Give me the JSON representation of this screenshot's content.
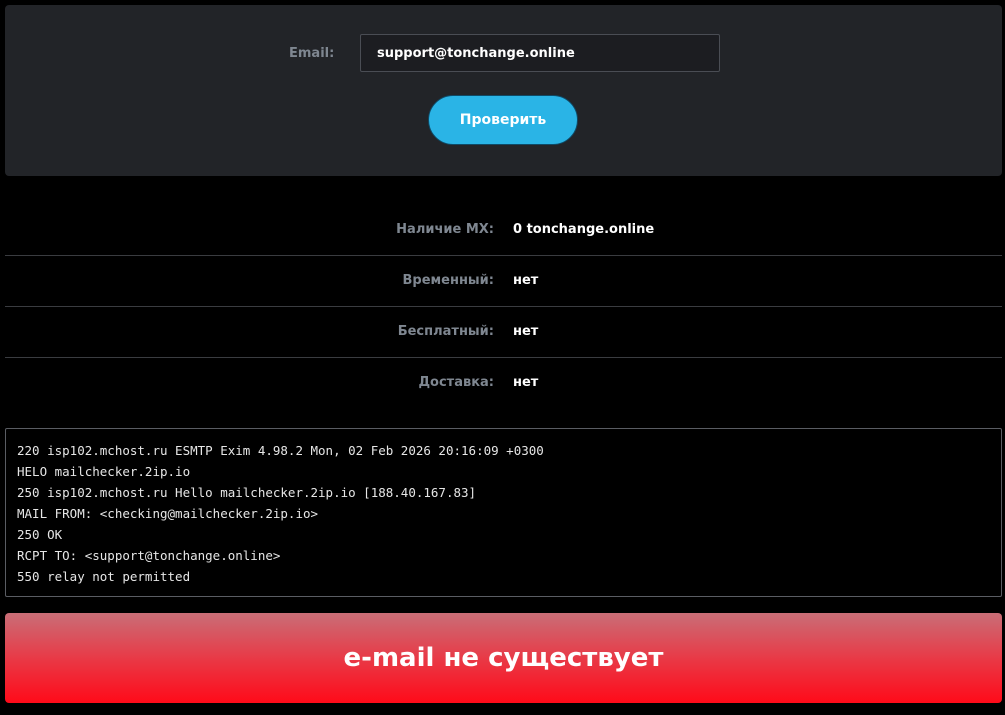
{
  "form": {
    "email_label": "Email:",
    "email_value": "support@tonchange.online",
    "check_button_label": "Проверить"
  },
  "results": [
    {
      "label": "Наличие MX:",
      "value": "0 tonchange.online"
    },
    {
      "label": "Временный:",
      "value": "нет"
    },
    {
      "label": "Бесплатный:",
      "value": "нет"
    },
    {
      "label": "Доставка:",
      "value": "нет"
    }
  ],
  "log": [
    "220 isp102.mchost.ru ESMTP Exim 4.98.2 Mon, 02 Feb 2026 20:16:09 +0300",
    "HELO mailchecker.2ip.io",
    "250 isp102.mchost.ru Hello mailchecker.2ip.io [188.40.167.83]",
    "MAIL FROM: <checking@mailchecker.2ip.io>",
    "250 OK",
    "RCPT TO: <support@tonchange.online>",
    "550 relay not permitted"
  ],
  "verdict": {
    "text": "e-mail не существует",
    "color": "#ff0a19"
  },
  "colors": {
    "accent": "#2ab4e6",
    "panel": "#222428",
    "label": "#7f8791"
  }
}
